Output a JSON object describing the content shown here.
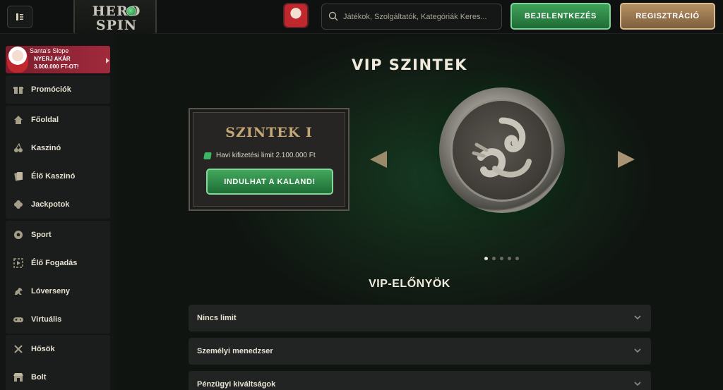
{
  "header": {
    "logo_line1": "HERO",
    "logo_line2": "SPIN",
    "search_placeholder": "Játékok, Szolgáltatók, Kategóriák Keres...",
    "login_label": "BEJELENTKEZÉS",
    "register_label": "REGISZTRÁCIÓ"
  },
  "sidebar": {
    "promo": {
      "title": "Santa's Slope",
      "line2": "NYERJ AKÁR",
      "line3": "3.000.000 FT-OT!"
    },
    "groups": [
      {
        "items": [
          {
            "label": "Promóciók",
            "icon": "gift-icon"
          }
        ]
      },
      {
        "items": [
          {
            "label": "Főoldal",
            "icon": "home-icon"
          },
          {
            "label": "Kaszinó",
            "icon": "cherries-icon"
          },
          {
            "label": "Élő Kaszinó",
            "icon": "cards-icon"
          },
          {
            "label": "Jackpotok",
            "icon": "clover-icon"
          }
        ]
      },
      {
        "items": [
          {
            "label": "Sport",
            "icon": "ball-icon"
          },
          {
            "label": "Élő Fogadás",
            "icon": "live-icon"
          },
          {
            "label": "Lóverseny",
            "icon": "horse-icon"
          },
          {
            "label": "Virtuális",
            "icon": "gamepad-icon"
          }
        ]
      },
      {
        "items": [
          {
            "label": "Hősök",
            "icon": "swords-icon"
          },
          {
            "label": "Bolt",
            "icon": "shop-icon"
          }
        ]
      }
    ]
  },
  "main": {
    "title": "VIP SZINTEK",
    "level_card": {
      "title": "SZINTEK I",
      "limit_text": "Havi kifizetési limit 2.100.000 Ft",
      "button_label": "INDULHAT A KALAND!"
    },
    "carousel": {
      "dot_count": 5,
      "active_index": 0
    },
    "benefits_title": "VIP-ELŐNYÖK",
    "benefits": [
      {
        "label": "Nincs limit"
      },
      {
        "label": "Személyi menedzser"
      },
      {
        "label": "Pénzügyi kiváltságok"
      }
    ]
  },
  "colors": {
    "login_green": "#2f8a47",
    "register_gold": "#a0805a",
    "card_title_gold": "#c4a775",
    "background": "#111412"
  }
}
